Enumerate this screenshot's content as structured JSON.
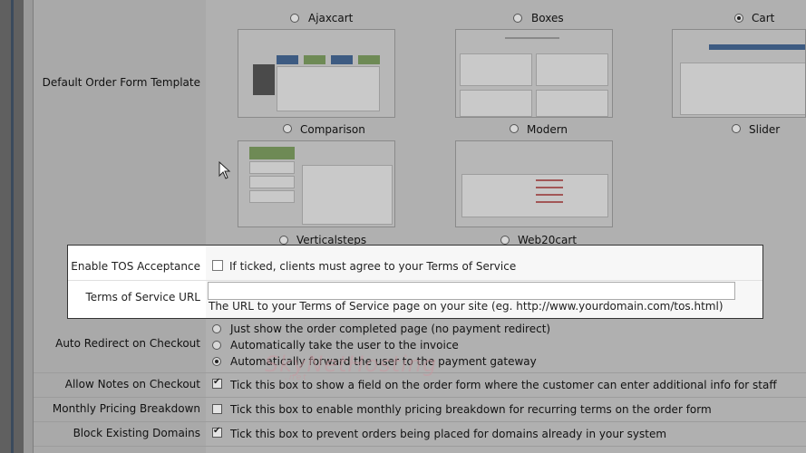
{
  "templates": {
    "label": "Default Order Form Template",
    "items": [
      {
        "name": "Ajaxcart",
        "selected": false
      },
      {
        "name": "Boxes",
        "selected": false
      },
      {
        "name": "Cart",
        "selected": true
      },
      {
        "name": "Comparison",
        "selected": false
      },
      {
        "name": "Modern",
        "selected": false
      },
      {
        "name": "Slider",
        "selected": false
      },
      {
        "name": "Verticalsteps",
        "selected": false
      },
      {
        "name": "Web20cart",
        "selected": false
      }
    ]
  },
  "tos": {
    "enable_label": "Enable TOS Acceptance",
    "enable_desc": "If ticked, clients must agree to your Terms of Service",
    "enabled": false,
    "url_label": "Terms of Service URL",
    "url_value": "",
    "url_desc": "The URL to your Terms of Service page on your site (eg. http://www.yourdomain.com/tos.html)"
  },
  "auto_redirect": {
    "label": "Auto Redirect on Checkout",
    "options": [
      {
        "text": "Just show the order completed page (no payment redirect)",
        "selected": false
      },
      {
        "text": "Automatically take the user to the invoice",
        "selected": false
      },
      {
        "text": "Automatically forward the user to the payment gateway",
        "selected": true
      }
    ]
  },
  "allow_notes": {
    "label": "Allow Notes on Checkout",
    "desc": "Tick this box to show a field on the order form where the customer can enter additional info for staff",
    "checked": true
  },
  "monthly_pricing": {
    "label": "Monthly Pricing Breakdown",
    "desc": "Tick this box to enable monthly pricing breakdown for recurring terms on the order form",
    "checked": false
  },
  "block_domains": {
    "label": "Block Existing Domains",
    "desc": "Tick this box to prevent orders being placed for domains already in your system",
    "checked": true
  },
  "watermark": {
    "text": "SkyNetHosting",
    "sub": ".net"
  }
}
